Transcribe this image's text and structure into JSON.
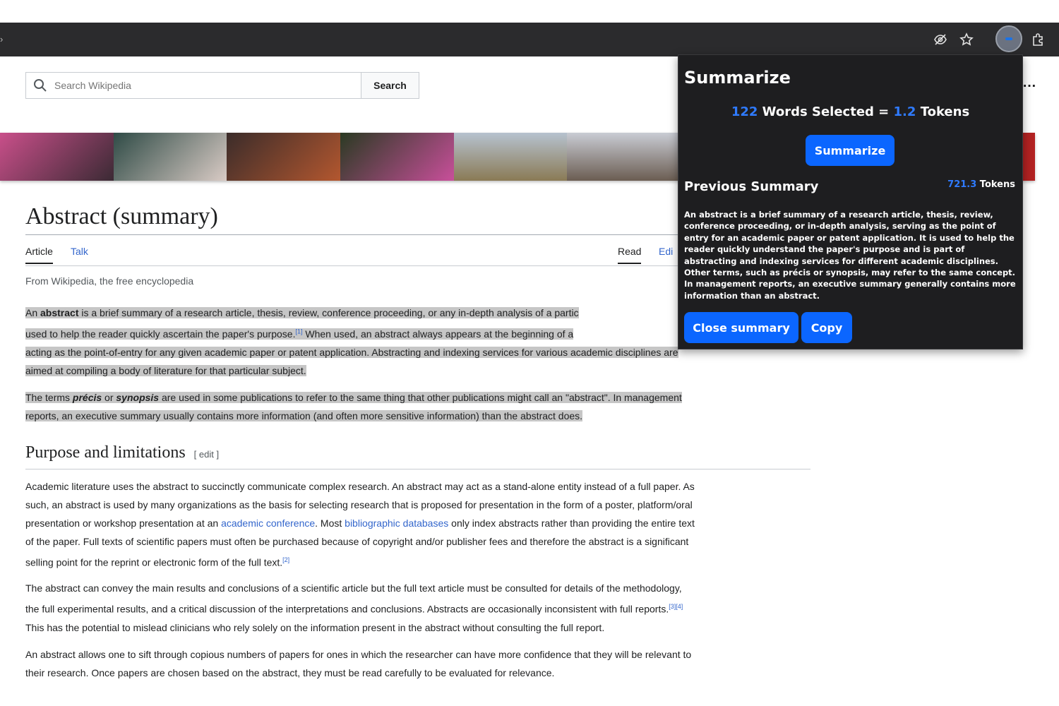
{
  "browser": {
    "icons": [
      "eye-off-icon",
      "star-icon",
      "extension-icon",
      "puzzle-icon"
    ]
  },
  "wiki": {
    "search": {
      "placeholder": "Search Wikipedia",
      "button": "Search"
    },
    "menu": "…",
    "title": "Abstract (summary)",
    "tabs": {
      "article": "Article",
      "talk": "Talk",
      "read": "Read",
      "edit": "Edi"
    },
    "tagline": "From Wikipedia, the free encyclopedia",
    "p1": {
      "t1": "An ",
      "bold": "abstract",
      "t2": " is a brief summary of a research article, thesis, review, conference proceeding, or any in-depth analysis of a partic",
      "t3": "used to help the reader quickly ascertain the paper's purpose.",
      "ref1": "[1]",
      "t4": " When used, an abstract always appears at the beginning of a",
      "t5": "acting as the point-of-entry for any given academic paper or patent application. Abstracting and indexing services for various academic disciplines are",
      "t6": "aimed at compiling a body of literature for that particular subject."
    },
    "p2": {
      "t1": "The terms ",
      "b1": "précis",
      "t2": " or ",
      "b2": "synopsis",
      "t3": " are used in some publications to refer to the same thing that other publications might call an \"abstract\". In management",
      "t4": "reports, an executive summary usually contains more information (and often more sensitive information) than the abstract does."
    },
    "section": {
      "title": "Purpose and limitations",
      "edit": "[ edit ]"
    },
    "p3": {
      "t1": "Academic literature uses the abstract to succinctly communicate complex research. An abstract may act as a stand-alone entity instead of a full paper. As",
      "t2": "such, an abstract is used by many organizations as the basis for selecting research that is proposed for presentation in the form of a poster, platform/oral",
      "t3": "presentation or workshop presentation at an ",
      "link1": "academic conference",
      "t4": ". Most ",
      "link2": "bibliographic databases",
      "t5": " only index abstracts rather than providing the entire text",
      "t6": "of the paper. Full texts of scientific papers must often be purchased because of copyright and/or publisher fees and therefore the abstract is a significant",
      "t7": "selling point for the reprint or electronic form of the full text.",
      "ref2": "[2]"
    },
    "p4": {
      "t1": "The abstract can convey the main results and conclusions of a scientific article but the full text article must be consulted for details of the methodology,",
      "t2": "the full experimental results, and a critical discussion of the interpretations and conclusions. Abstracts are occasionally inconsistent with full reports.",
      "ref34": "[3][4]",
      "t3": "This has the potential to mislead clinicians who rely solely on the information present in the abstract without consulting the full report."
    },
    "p5": {
      "t1": "An abstract allows one to sift through copious numbers of papers for ones in which the researcher can have more confidence that they will be relevant to",
      "t2": "their research. Once papers are chosen based on the abstract, they must be read carefully to be evaluated for relevance."
    }
  },
  "popup": {
    "title": "Summarize",
    "words": "122",
    "words_label": " Words Selected = ",
    "tokens": "1.2",
    "tokens_label": " Tokens",
    "summarize_button": "Summarize",
    "previous_title": "Previous Summary",
    "previous_tokens": "721.3",
    "previous_tokens_label": " Tokens",
    "summary": "An abstract is a brief summary of a research article, thesis, review, conference proceeding, or in-depth analysis, serving as the point of entry for an academic paper or patent application. It is used to help the reader quickly understand the paper's purpose and is part of abstracting and indexing services for different academic disciplines. Other terms, such as précis or synopsis, may refer to the same concept. In management reports, an executive summary generally contains more information than an abstract.",
    "close_button": "Close summary",
    "copy_button": "Copy",
    "accent": "#0b66ff"
  }
}
